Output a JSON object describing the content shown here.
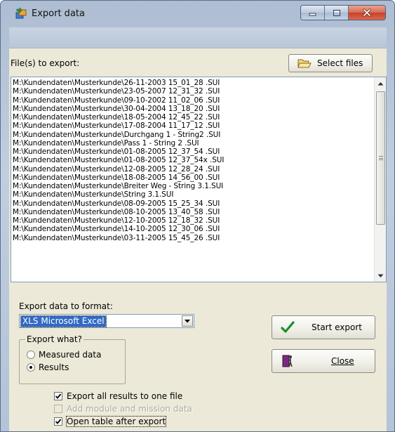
{
  "window": {
    "title": "Export data",
    "app_icon": "export-app-icon",
    "caption": {
      "minimize_icon": "minimize-icon",
      "maximize_icon": "maximize-icon",
      "close_icon": "close-icon"
    }
  },
  "files": {
    "label": "File(s) to export:",
    "select_button": "Select files",
    "select_icon": "folder-open-icon",
    "items": [
      "M:\\Kundendaten\\Musterkunde\\26-11-2003  15_01_28 .SUI",
      "M:\\Kundendaten\\Musterkunde\\23-05-2007  12_31_32 .SUI",
      "M:\\Kundendaten\\Musterkunde\\09-10-2002  11_02_06 .SUI",
      "M:\\Kundendaten\\Musterkunde\\30-04-2004  13_18_20 .SUI",
      "M:\\Kundendaten\\Musterkunde\\18-05-2004  12_45_22 .SUI",
      "M:\\Kundendaten\\Musterkunde\\17-08-2004  11_17_12 .SUI",
      "M:\\Kundendaten\\Musterkunde\\Durchgang 1 - String2 .SUI",
      "M:\\Kundendaten\\Musterkunde\\Pass 1 - String 2 .SUI",
      "M:\\Kundendaten\\Musterkunde\\01-08-2005  12_37_54 .SUI",
      "M:\\Kundendaten\\Musterkunde\\01-08-2005  12_37_54x .SUI",
      "M:\\Kundendaten\\Musterkunde\\12-08-2005  12_28_24 .SUI",
      "M:\\Kundendaten\\Musterkunde\\18-08-2005  14_56_00 .SUI",
      "M:\\Kundendaten\\Musterkunde\\Breiter Weg - String 3.1.SUI",
      "M:\\Kundendaten\\Musterkunde\\String 3.1.SUI",
      "M:\\Kundendaten\\Musterkunde\\08-09-2005  15_25_34 .SUI",
      "M:\\Kundendaten\\Musterkunde\\08-10-2005  13_40_58 .SUI",
      "M:\\Kundendaten\\Musterkunde\\12-10-2005  12_18_32 .SUI",
      "M:\\Kundendaten\\Musterkunde\\14-10-2005  12_30_06 .SUI",
      "M:\\Kundendaten\\Musterkunde\\03-11-2005  15_45_26 .SUI"
    ]
  },
  "format": {
    "label": "Export data to format:",
    "selected": "XLS Microsoft Excel"
  },
  "export_what": {
    "title": "Export what?",
    "options": [
      {
        "label": "Measured data",
        "checked": false
      },
      {
        "label": "Results",
        "checked": true
      }
    ]
  },
  "checkboxes": [
    {
      "label": "Export all results to one file",
      "checked": true,
      "disabled": false
    },
    {
      "label": "Add module and mission data",
      "checked": false,
      "disabled": true
    },
    {
      "label": "Open table after export",
      "checked": true,
      "disabled": false
    }
  ],
  "actions": {
    "start_label": "Start export",
    "start_icon": "checkmark-icon",
    "close_label": "Close",
    "close_icon": "exit-door-icon"
  },
  "colors": {
    "selection": "#316ac5",
    "checkmark": "#1a8f2a",
    "dialog_bg": "#ece9d8"
  }
}
